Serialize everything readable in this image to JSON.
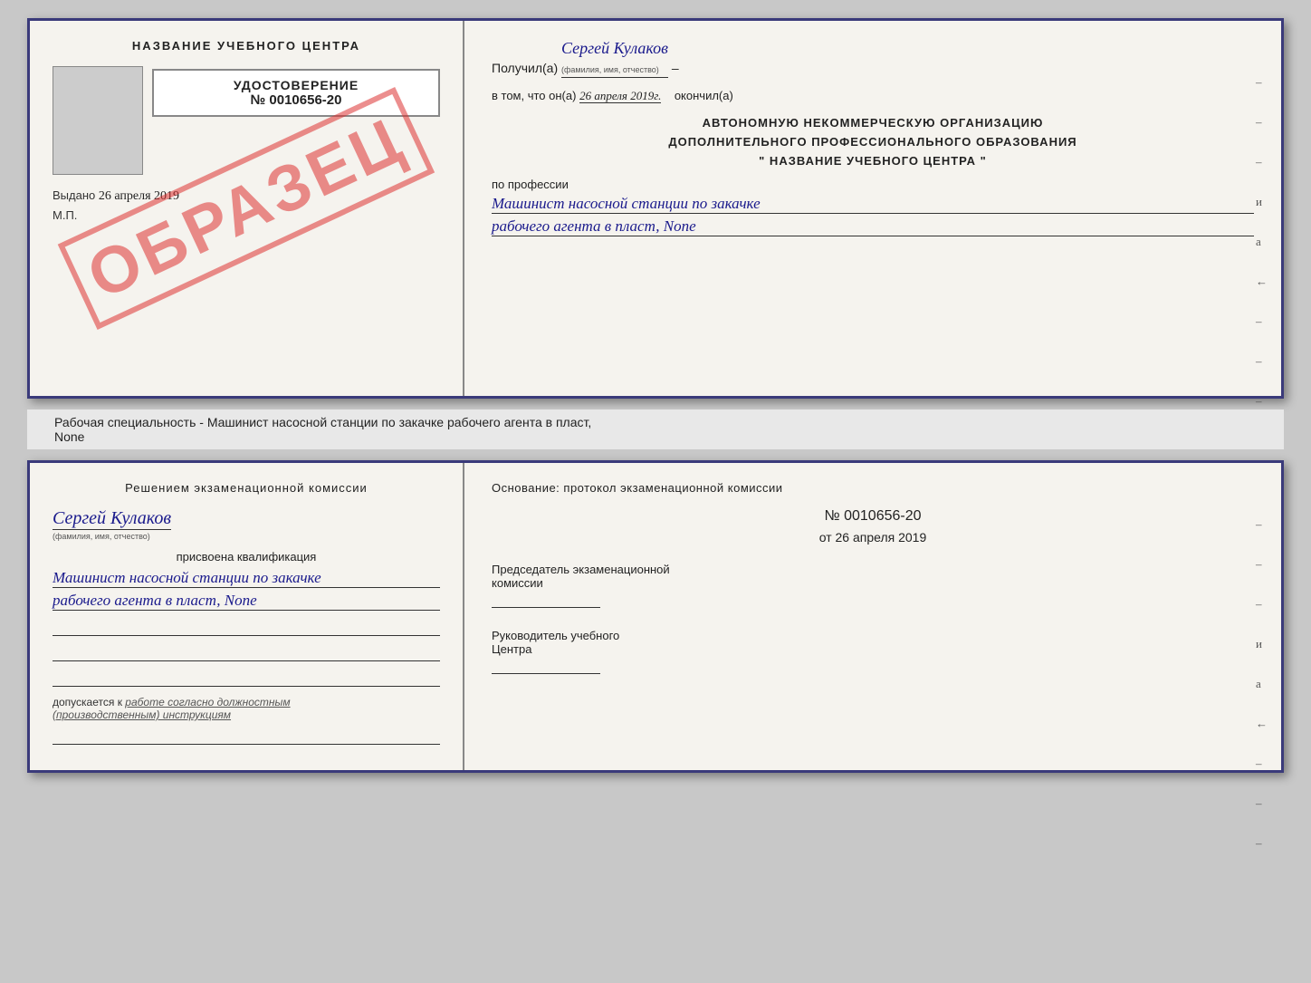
{
  "page": {
    "background": "#c8c8c8"
  },
  "top_doc": {
    "left": {
      "center_title": "НАЗВАНИЕ УЧЕБНОГО ЦЕНТРА",
      "watermark": "ОБРАЗЕЦ",
      "udostoverenie_title": "УДОСТОВЕРЕНИЕ",
      "udostoverenie_num": "№ 0010656-20",
      "vydano_label": "Выдано",
      "vydano_date": "26 апреля 2019",
      "mp_label": "М.П."
    },
    "right": {
      "poluchil_label": "Получил(а)",
      "poluchil_name": "Сергей Кулаков",
      "familiya_hint": "(фамилия, имя, отчество)",
      "vtom_label": "в том, что он(а)",
      "vtom_date": "26 апреля 2019г.",
      "okonchil_label": "окончил(а)",
      "org_line1": "АВТОНОМНУЮ НЕКОММЕРЧЕСКУЮ ОРГАНИЗАЦИЮ",
      "org_line2": "ДОПОЛНИТЕЛЬНОГО ПРОФЕССИОНАЛЬНОГО ОБРАЗОВАНИЯ",
      "org_line3": "\"   НАЗВАНИЕ УЧЕБНОГО ЦЕНТРА   \"",
      "po_professii_label": "по профессии",
      "profession_line1": "Машинист насосной станции по закачке",
      "profession_line2": "рабочего агента в пласт, None",
      "dashes": [
        "-",
        "-",
        "-",
        "и",
        "а",
        "←",
        "-",
        "-",
        "-"
      ]
    }
  },
  "subtitle": {
    "text": "Рабочая специальность - Машинист насосной станции по закачке рабочего агента в пласт,",
    "text2": "None"
  },
  "bottom_doc": {
    "left": {
      "resheniem_title": "Решением  экзаменационной  комиссии",
      "person_name": "Сергей Кулаков",
      "familiya_hint": "(фамилия, имя, отчество)",
      "prisvoena": "присвоена квалификация",
      "kvalf_line1": "Машинист насосной станции по закачке",
      "kvalf_line2": "рабочего агента в пласт, None",
      "dopuskaetsya_label": "допускается к",
      "dopuskaetsya_val": "работе согласно должностным",
      "dopuskaetsya_val2": "(производственным) инструкциям"
    },
    "right": {
      "osnovanie_label": "Основание: протокол экзаменационной  комиссии",
      "protocol_num": "№ 0010656-20",
      "protocol_date_prefix": "от",
      "protocol_date": "26 апреля 2019",
      "predsedatel_label": "Председатель экзаменационной",
      "predsedatel_label2": "комиссии",
      "rukovoditel_label": "Руководитель учебного",
      "rukovoditel_label2": "Центра",
      "dashes": [
        "-",
        "-",
        "-",
        "и",
        "а",
        "←",
        "-",
        "-",
        "-"
      ]
    }
  }
}
